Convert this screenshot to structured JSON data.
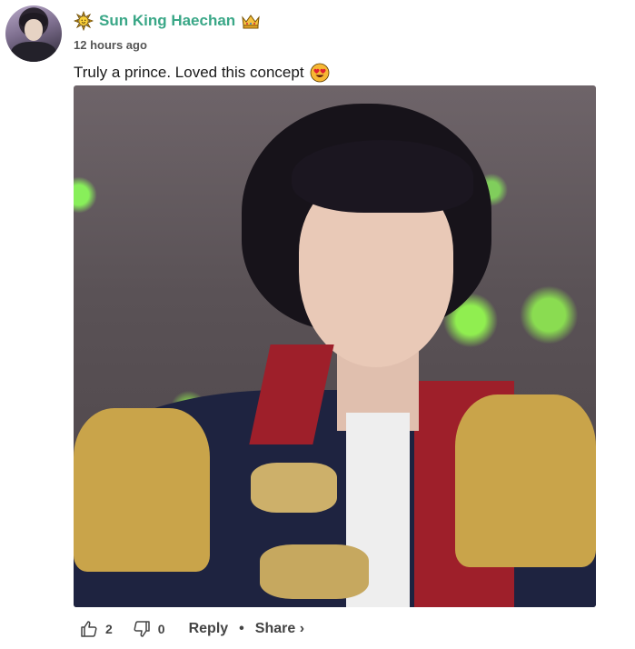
{
  "comment": {
    "author": "Sun King Haechan",
    "author_prefix_icon": "sun-icon",
    "author_suffix_icon": "crown-icon",
    "timestamp": "12 hours ago",
    "text": "Truly a prince. Loved this concept",
    "text_emoji_icon": "heart-eyes-icon",
    "accent_color": "#3aa787"
  },
  "actions": {
    "like_count": "2",
    "dislike_count": "0",
    "reply_label": "Reply",
    "separator": "•",
    "share_label": "Share ›"
  }
}
